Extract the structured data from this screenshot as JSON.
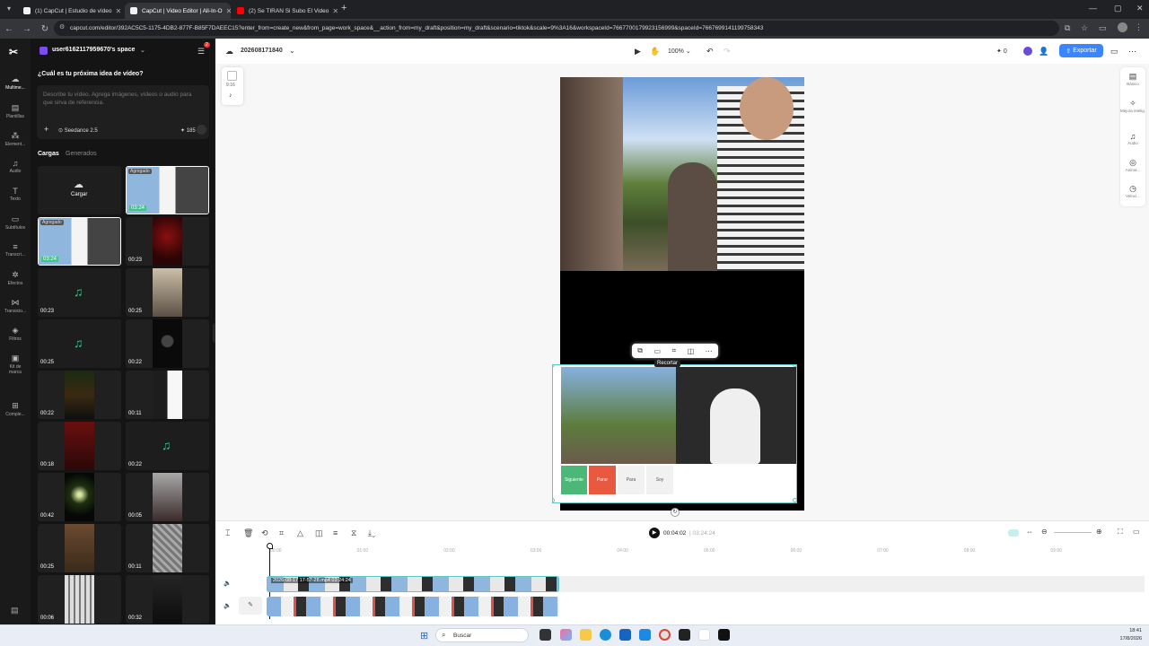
{
  "browser": {
    "tabs": [
      {
        "label": "(1) CapCut | Estudio de vídeo",
        "favicon_color": "#f2f2f2"
      },
      {
        "label": "CapCut | Video Editor | All-In-O",
        "favicon_color": "#f2f2f2"
      },
      {
        "label": "(2) Se TIRAN Si Subo El Video",
        "favicon_color": "#ff0000"
      }
    ],
    "new_tab": "+",
    "url": "capcut.com/editor/392AC5C5-1175-4DB2-877F-B85F7DAEEC15?enter_from=create_new&from_page=work_space&__action_from=my_draft&position=my_draft&scenario=tiktok&scale=9%3A16&workspaceId=7667700179923156999&spaceId=7667699141199758343"
  },
  "workspace": {
    "name": "user6162117959670's space",
    "badge": "2"
  },
  "leftnav": [
    {
      "label": "Multime...",
      "icon": "cloud-icon"
    },
    {
      "label": "Plantillas",
      "icon": "template-icon"
    },
    {
      "label": "Element...",
      "icon": "elements-icon"
    },
    {
      "label": "Audio",
      "icon": "music-icon"
    },
    {
      "label": "Texto",
      "icon": "text-icon"
    },
    {
      "label": "Subtítulos",
      "icon": "caption-icon"
    },
    {
      "label": "Transcri...",
      "icon": "transcript-icon"
    },
    {
      "label": "Efectos",
      "icon": "effects-icon"
    },
    {
      "label": "Transicio...",
      "icon": "transition-icon"
    },
    {
      "label": "Filtros",
      "icon": "filter-icon"
    },
    {
      "label": "Kit de marca",
      "icon": "brand-icon"
    },
    {
      "label": "Comple...",
      "icon": "plugins-icon"
    }
  ],
  "ai_prompt": {
    "title": "¿Cuál es tu próxima idea de vídeo?",
    "placeholder": "Describe tu vídeo. Agrega imágenes, vídeos o audio para que sirva de referencia.",
    "model": "Seedance 2.5",
    "credits": "185"
  },
  "media_tabs": [
    "Cargas",
    "Generados"
  ],
  "upload_label": "Cargar",
  "added_tag": "Agregado",
  "media": [
    {
      "dur": "03:24",
      "kind": "video-a",
      "tag": true
    },
    {
      "dur": "03:24",
      "kind": "video-a",
      "tag": true
    },
    {
      "dur": "00:23",
      "kind": "red"
    },
    {
      "dur": "00:23",
      "kind": "audio"
    },
    {
      "dur": "00:25",
      "kind": "face"
    },
    {
      "dur": "00:25",
      "kind": "audio"
    },
    {
      "dur": "00:22",
      "kind": "silhouette"
    },
    {
      "dur": "00:22",
      "kind": "forest"
    },
    {
      "dur": "00:11",
      "kind": "white-fig"
    },
    {
      "dur": "00:18",
      "kind": "red2"
    },
    {
      "dur": "00:22",
      "kind": "audio"
    },
    {
      "dur": "00:42",
      "kind": "night"
    },
    {
      "dur": "00:05",
      "kind": "people"
    },
    {
      "dur": "00:25",
      "kind": "brown"
    },
    {
      "dur": "00:11",
      "kind": "gray"
    },
    {
      "dur": "00:06",
      "kind": "building"
    },
    {
      "dur": "00:32",
      "kind": "dark"
    }
  ],
  "editor": {
    "project_name": "202608171840",
    "zoom": "100%",
    "export_label": "Exportar",
    "collab_count": "0",
    "aspect": "9:16"
  },
  "right_tools": [
    {
      "label": "Básico",
      "icon": "basic-icon"
    },
    {
      "label": "Mejora intelig.",
      "icon": "sparkle-icon"
    },
    {
      "label": "Audio",
      "icon": "audio-icon"
    },
    {
      "label": "Anima...",
      "icon": "animation-icon"
    },
    {
      "label": "Veloci...",
      "icon": "speed-icon"
    }
  ],
  "float_toolbar": {
    "tooltip": "Recortar"
  },
  "buttons_row": [
    "Siguiente",
    "Parar",
    "Para",
    "Soy"
  ],
  "timeline": {
    "current_time": "00:04:02",
    "total_time": "03:24:24",
    "ruler": [
      "00:00",
      "01:00",
      "02:00",
      "03:00",
      "04:00",
      "05:00",
      "06:00",
      "07:00",
      "08:00",
      "09:00"
    ],
    "clip_label": "2026-08-17 17-57-28.mp4   03:24:24"
  },
  "taskbar": {
    "search": "Buscar",
    "time": "18:41",
    "date": "17/8/2026"
  }
}
